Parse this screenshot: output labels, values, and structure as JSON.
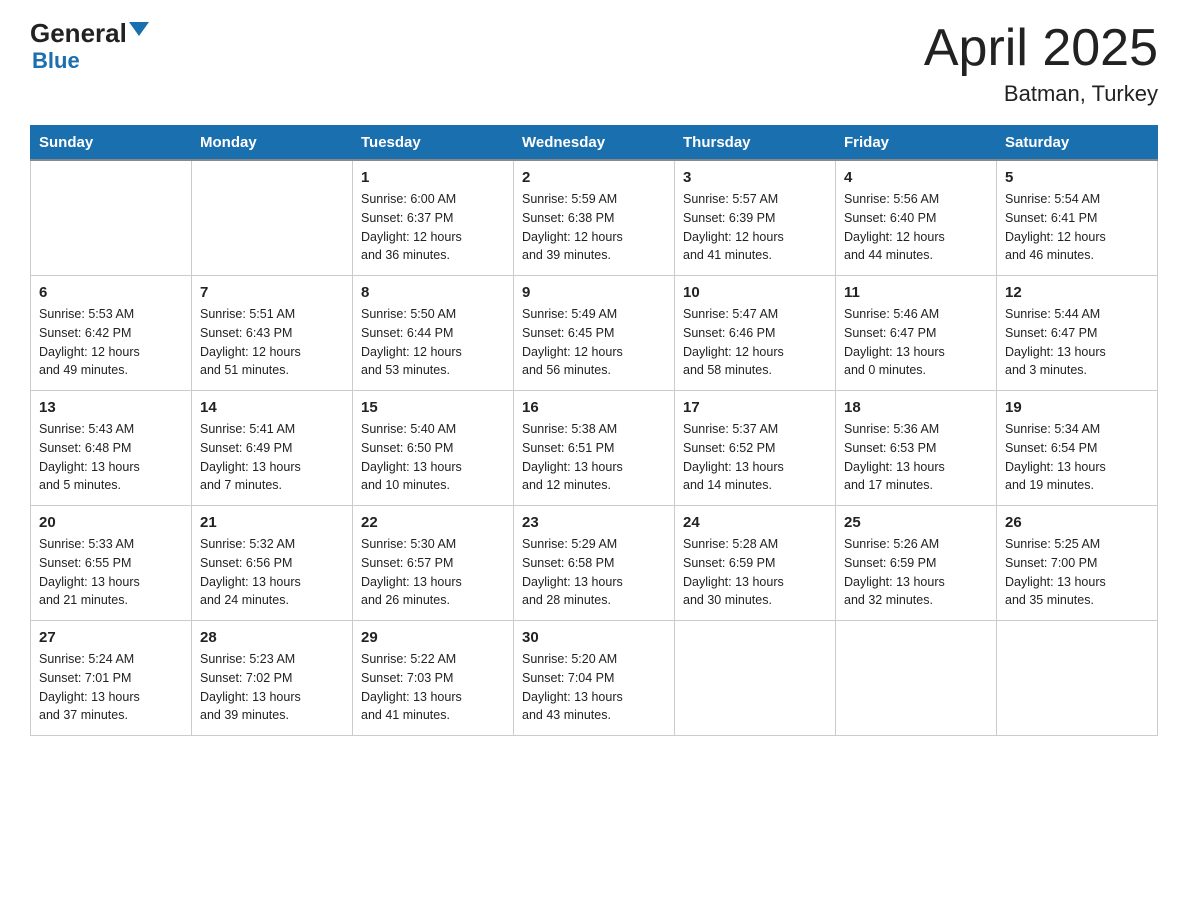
{
  "header": {
    "logo_general": "General",
    "logo_blue": "Blue",
    "month_year": "April 2025",
    "location": "Batman, Turkey"
  },
  "weekdays": [
    "Sunday",
    "Monday",
    "Tuesday",
    "Wednesday",
    "Thursday",
    "Friday",
    "Saturday"
  ],
  "weeks": [
    [
      {
        "day": "",
        "info": ""
      },
      {
        "day": "",
        "info": ""
      },
      {
        "day": "1",
        "info": "Sunrise: 6:00 AM\nSunset: 6:37 PM\nDaylight: 12 hours\nand 36 minutes."
      },
      {
        "day": "2",
        "info": "Sunrise: 5:59 AM\nSunset: 6:38 PM\nDaylight: 12 hours\nand 39 minutes."
      },
      {
        "day": "3",
        "info": "Sunrise: 5:57 AM\nSunset: 6:39 PM\nDaylight: 12 hours\nand 41 minutes."
      },
      {
        "day": "4",
        "info": "Sunrise: 5:56 AM\nSunset: 6:40 PM\nDaylight: 12 hours\nand 44 minutes."
      },
      {
        "day": "5",
        "info": "Sunrise: 5:54 AM\nSunset: 6:41 PM\nDaylight: 12 hours\nand 46 minutes."
      }
    ],
    [
      {
        "day": "6",
        "info": "Sunrise: 5:53 AM\nSunset: 6:42 PM\nDaylight: 12 hours\nand 49 minutes."
      },
      {
        "day": "7",
        "info": "Sunrise: 5:51 AM\nSunset: 6:43 PM\nDaylight: 12 hours\nand 51 minutes."
      },
      {
        "day": "8",
        "info": "Sunrise: 5:50 AM\nSunset: 6:44 PM\nDaylight: 12 hours\nand 53 minutes."
      },
      {
        "day": "9",
        "info": "Sunrise: 5:49 AM\nSunset: 6:45 PM\nDaylight: 12 hours\nand 56 minutes."
      },
      {
        "day": "10",
        "info": "Sunrise: 5:47 AM\nSunset: 6:46 PM\nDaylight: 12 hours\nand 58 minutes."
      },
      {
        "day": "11",
        "info": "Sunrise: 5:46 AM\nSunset: 6:47 PM\nDaylight: 13 hours\nand 0 minutes."
      },
      {
        "day": "12",
        "info": "Sunrise: 5:44 AM\nSunset: 6:47 PM\nDaylight: 13 hours\nand 3 minutes."
      }
    ],
    [
      {
        "day": "13",
        "info": "Sunrise: 5:43 AM\nSunset: 6:48 PM\nDaylight: 13 hours\nand 5 minutes."
      },
      {
        "day": "14",
        "info": "Sunrise: 5:41 AM\nSunset: 6:49 PM\nDaylight: 13 hours\nand 7 minutes."
      },
      {
        "day": "15",
        "info": "Sunrise: 5:40 AM\nSunset: 6:50 PM\nDaylight: 13 hours\nand 10 minutes."
      },
      {
        "day": "16",
        "info": "Sunrise: 5:38 AM\nSunset: 6:51 PM\nDaylight: 13 hours\nand 12 minutes."
      },
      {
        "day": "17",
        "info": "Sunrise: 5:37 AM\nSunset: 6:52 PM\nDaylight: 13 hours\nand 14 minutes."
      },
      {
        "day": "18",
        "info": "Sunrise: 5:36 AM\nSunset: 6:53 PM\nDaylight: 13 hours\nand 17 minutes."
      },
      {
        "day": "19",
        "info": "Sunrise: 5:34 AM\nSunset: 6:54 PM\nDaylight: 13 hours\nand 19 minutes."
      }
    ],
    [
      {
        "day": "20",
        "info": "Sunrise: 5:33 AM\nSunset: 6:55 PM\nDaylight: 13 hours\nand 21 minutes."
      },
      {
        "day": "21",
        "info": "Sunrise: 5:32 AM\nSunset: 6:56 PM\nDaylight: 13 hours\nand 24 minutes."
      },
      {
        "day": "22",
        "info": "Sunrise: 5:30 AM\nSunset: 6:57 PM\nDaylight: 13 hours\nand 26 minutes."
      },
      {
        "day": "23",
        "info": "Sunrise: 5:29 AM\nSunset: 6:58 PM\nDaylight: 13 hours\nand 28 minutes."
      },
      {
        "day": "24",
        "info": "Sunrise: 5:28 AM\nSunset: 6:59 PM\nDaylight: 13 hours\nand 30 minutes."
      },
      {
        "day": "25",
        "info": "Sunrise: 5:26 AM\nSunset: 6:59 PM\nDaylight: 13 hours\nand 32 minutes."
      },
      {
        "day": "26",
        "info": "Sunrise: 5:25 AM\nSunset: 7:00 PM\nDaylight: 13 hours\nand 35 minutes."
      }
    ],
    [
      {
        "day": "27",
        "info": "Sunrise: 5:24 AM\nSunset: 7:01 PM\nDaylight: 13 hours\nand 37 minutes."
      },
      {
        "day": "28",
        "info": "Sunrise: 5:23 AM\nSunset: 7:02 PM\nDaylight: 13 hours\nand 39 minutes."
      },
      {
        "day": "29",
        "info": "Sunrise: 5:22 AM\nSunset: 7:03 PM\nDaylight: 13 hours\nand 41 minutes."
      },
      {
        "day": "30",
        "info": "Sunrise: 5:20 AM\nSunset: 7:04 PM\nDaylight: 13 hours\nand 43 minutes."
      },
      {
        "day": "",
        "info": ""
      },
      {
        "day": "",
        "info": ""
      },
      {
        "day": "",
        "info": ""
      }
    ]
  ]
}
